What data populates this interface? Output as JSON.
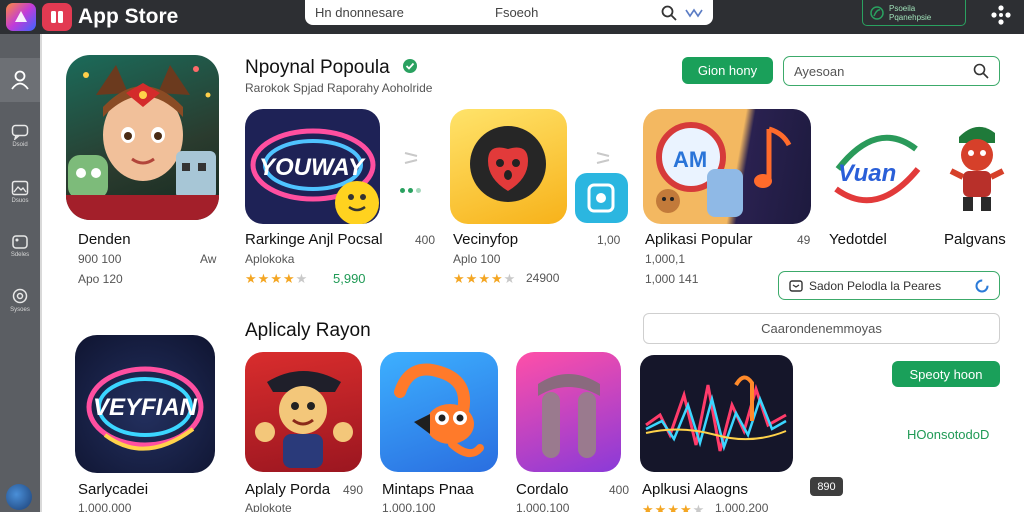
{
  "topbar": {
    "app_name": "App Store",
    "app_subtitle": "",
    "search_text_1": "Hn dnonnesare",
    "search_text_2": "Fsoeoh",
    "right_box_line1": "Psoeila",
    "right_box_line2": "Pqanehpsie"
  },
  "sidebar": {
    "items": [
      {
        "label": "Dsoid",
        "icon": "chat-icon"
      },
      {
        "label": "Dsuos",
        "icon": "image-icon"
      },
      {
        "label": "Sdeles",
        "icon": "tag-icon"
      },
      {
        "label": "Sysoes",
        "icon": "settings-icon"
      }
    ]
  },
  "header": {
    "title": "Npoynal Popoula",
    "subtitle": "Rarokok Spjad Raporahy Aoholride",
    "green_button": "Gion hony",
    "search_placeholder": "Ayesoan"
  },
  "featured": {
    "name": "Denden",
    "line2": "900 100",
    "line2b": "Aw",
    "line3": "Apo 120"
  },
  "row1": [
    {
      "name": "Rarkinge Anjl Pocsal",
      "sub": "Aplokoka",
      "price": "400",
      "rating": 4,
      "rating_text": "5,990"
    },
    {
      "name": "Vecinyfop",
      "sub": "Aplo 100",
      "price": "1,00",
      "rating": 4,
      "rating_text": "24900"
    },
    {
      "name": "Aplikasi Popular",
      "sub": "1,000,1",
      "price": "49",
      "sub2": "1,000 141"
    },
    {
      "name": "Yedotdel"
    },
    {
      "name": "Palgvans"
    }
  ],
  "row1_action": "Sadon Pelodla la Peares",
  "section2": {
    "title": "Aplicaly Rayon",
    "outline_box": "Caarondenemmoyas",
    "green_button": "Speoty hoon",
    "green_label": "HOonsotodoD"
  },
  "row2": [
    {
      "name": "Sarlycadei",
      "sub": "1,000,000"
    },
    {
      "name": "Aplaly Porda",
      "price": "490",
      "sub": "Aplokote"
    },
    {
      "name": "Mintaps Pnaa",
      "sub": "1,000,100"
    },
    {
      "name": "Cordalo",
      "price": "400",
      "sub": "1,000,100"
    },
    {
      "name": "Aplkusi Alaogns",
      "sub": "1,000,200"
    }
  ],
  "badge": "890",
  "colors": {
    "accent": "#1aa05a",
    "star": "#f4a623",
    "topbar": "#2d2f33",
    "sidebar": "#5b5e63"
  }
}
